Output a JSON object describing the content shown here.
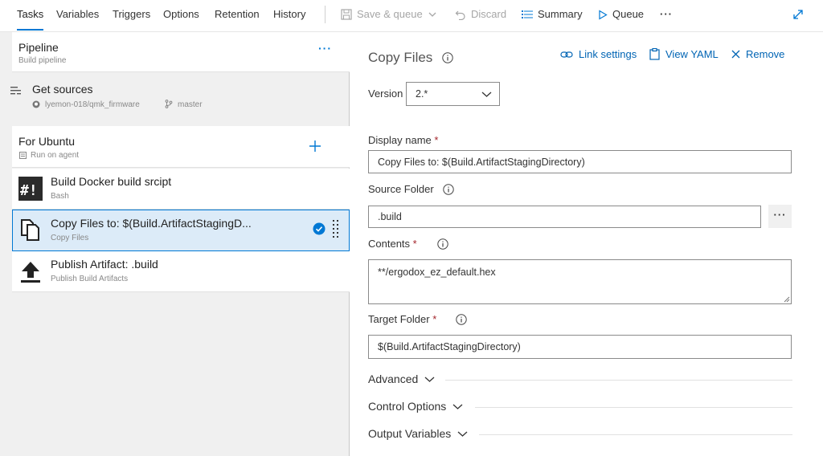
{
  "tabs": [
    {
      "label": "Tasks"
    },
    {
      "label": "Variables"
    },
    {
      "label": "Triggers"
    },
    {
      "label": "Options"
    },
    {
      "label": "Retention"
    },
    {
      "label": "History"
    }
  ],
  "toolbar": {
    "save_queue": "Save & queue",
    "discard": "Discard",
    "summary": "Summary",
    "queue": "Queue",
    "more": "···"
  },
  "pipeline": {
    "title": "Pipeline",
    "subtitle": "Build pipeline",
    "more": "···"
  },
  "get_sources": {
    "title": "Get sources",
    "repo": "lyemon-018/qmk_firmware",
    "branch": "master"
  },
  "phase": {
    "title": "For Ubuntu",
    "subtitle": "Run on agent"
  },
  "tasks": [
    {
      "name": "Build Docker build srcipt",
      "type": "Bash"
    },
    {
      "name": "Copy Files to: $(Build.ArtifactStagingD...",
      "type": "Copy Files"
    },
    {
      "name": "Publish Artifact: .build",
      "type": "Publish Build Artifacts"
    }
  ],
  "detail": {
    "title": "Copy Files",
    "links": {
      "link_settings": "Link settings",
      "view_yaml": "View YAML",
      "remove": "Remove"
    },
    "version_label": "Version",
    "version_value": "2.*",
    "display_name_label": "Display name",
    "display_name_value": "Copy Files to: $(Build.ArtifactStagingDirectory)",
    "source_folder_label": "Source Folder",
    "source_folder_value": ".build",
    "browse": "···",
    "contents_label": "Contents",
    "contents_value": "**/ergodox_ez_default.hex",
    "target_folder_label": "Target Folder",
    "target_folder_value": "$(Build.ArtifactStagingDirectory)",
    "required_mark": "*",
    "sections": {
      "advanced": "Advanced",
      "control_options": "Control Options",
      "output_variables": "Output Variables"
    }
  },
  "colors": {
    "accent": "#0078d4",
    "selected_bg": "#dcebf8",
    "required": "#a4262c"
  }
}
